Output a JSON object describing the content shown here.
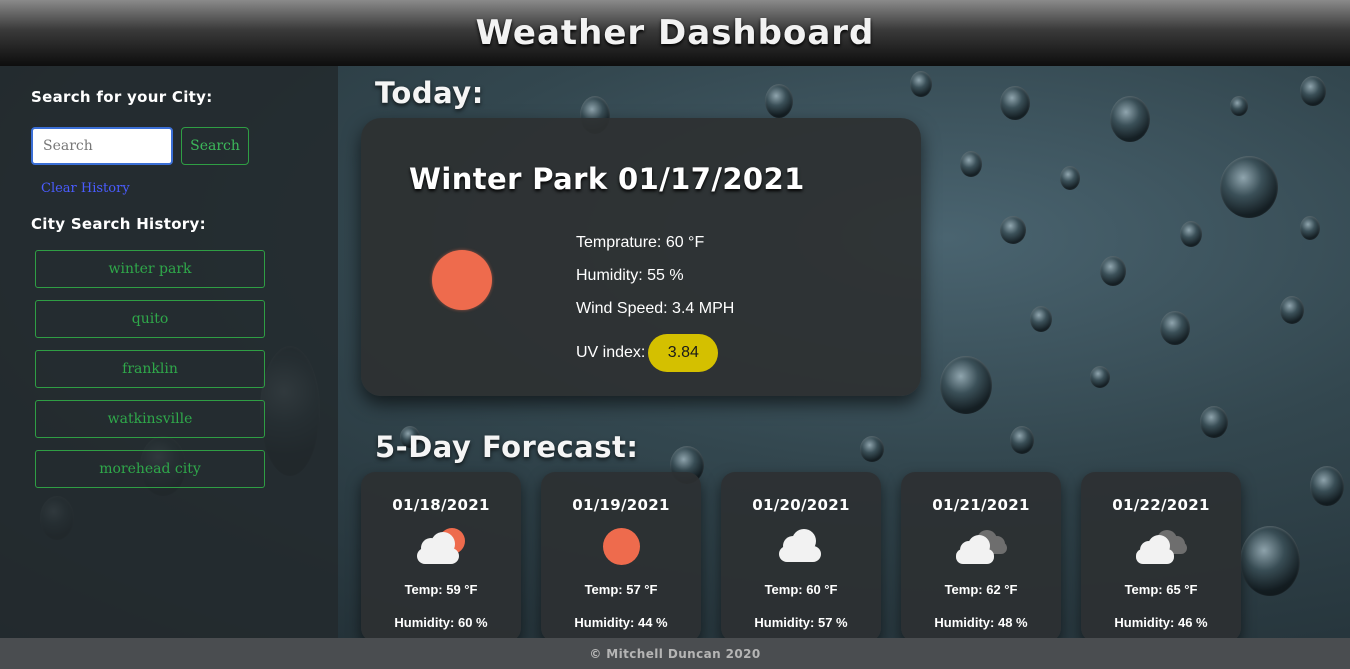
{
  "header": {
    "title": "Weather Dashboard"
  },
  "sidebar": {
    "search_heading": "Search for your City:",
    "search_placeholder": "Search",
    "search_button": "Search",
    "clear_history": "Clear History",
    "history_heading": "City Search History:",
    "history": [
      "winter park",
      "quito",
      "franklin",
      "watkinsville",
      "morehead city"
    ]
  },
  "today": {
    "section_title": "Today:",
    "city_date": "Winter Park 01/17/2021",
    "icon": "sun-icon",
    "temperature": "Temprature: 60 °F",
    "humidity": "Humidity: 55 %",
    "wind": "Wind Speed: 3.4 MPH",
    "uv_label": "UV index:",
    "uv_value": "3.84"
  },
  "forecast": {
    "section_title": "5-Day Forecast:",
    "days": [
      {
        "date": "01/18/2021",
        "icon": "partly-cloudy-sun-icon",
        "temp": "Temp: 59 °F",
        "humidity": "Humidity: 60 %"
      },
      {
        "date": "01/19/2021",
        "icon": "sun-icon",
        "temp": "Temp: 57 °F",
        "humidity": "Humidity: 44 %"
      },
      {
        "date": "01/20/2021",
        "icon": "cloud-icon",
        "temp": "Temp: 60 °F",
        "humidity": "Humidity: 57 %"
      },
      {
        "date": "01/21/2021",
        "icon": "broken-clouds-icon",
        "temp": "Temp: 62 °F",
        "humidity": "Humidity: 48 %"
      },
      {
        "date": "01/22/2021",
        "icon": "broken-clouds-icon",
        "temp": "Temp: 65 °F",
        "humidity": "Humidity: 46 %"
      }
    ]
  },
  "footer": {
    "text": "© Mitchell Duncan 2020"
  },
  "colors": {
    "sun": "#ee6b4d",
    "uv_badge": "#d4c000",
    "history_green": "#2fa84a",
    "clear_link": "#4a5cff"
  }
}
